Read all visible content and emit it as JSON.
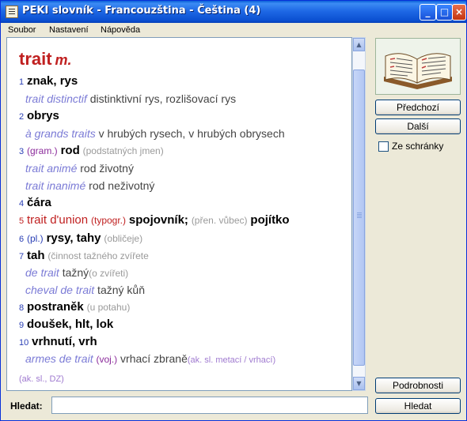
{
  "window": {
    "title": "PEKI slovník - Francouzština - Čeština  (4)",
    "min": "_",
    "max": "□",
    "close": "×"
  },
  "menu": [
    "Soubor",
    "Nastavení",
    "Nápověda"
  ],
  "entry": {
    "headword": "trait",
    "gender": "m.",
    "l1": {
      "num": "1",
      "text": "znak, rys"
    },
    "l2": {
      "fr": "trait distinctif",
      "cz": " distinktivní rys, rozlišovací rys"
    },
    "l3": {
      "num": "2",
      "text": "obrys"
    },
    "l4": {
      "fr": "à grands traits",
      "cz": " v hrubých rysech, v hrubých obrysech"
    },
    "l5": {
      "num": "3",
      "gram": "(gram.)",
      "text": "rod",
      "note": "(podstatných jmen)"
    },
    "l6": {
      "fr": "trait animé",
      "cz": " rod životný"
    },
    "l7": {
      "fr": "trait inanimé",
      "cz": " rod neživotný"
    },
    "l8": {
      "num": "4",
      "text": "čára"
    },
    "l9": {
      "num": "5",
      "phrase": "trait d'union",
      "typ": "(typogr.)",
      "text": "spojovník;",
      "note": "(přen. vůbec)",
      "text2": "pojítko"
    },
    "l10": {
      "num": "6",
      "gram": "(pl.)",
      "text": "rysy, tahy",
      "note": "(obličeje)"
    },
    "l11": {
      "num": "7",
      "text": "tah",
      "note": "(činnost tažného zvířete"
    },
    "l12": {
      "fr": "de trait",
      "cz": " tažný",
      "note": "(o zvířeti)"
    },
    "l13": {
      "fr": "cheval de trait",
      "cz": " tažný kůň"
    },
    "l14": {
      "num": "8",
      "text": "postraněk",
      "note": "(u potahu)"
    },
    "l15": {
      "num": "9",
      "text": "doušek, hlt, lok"
    },
    "l16": {
      "num": "10",
      "text": "vrhnutí, vrh"
    },
    "l17": {
      "fr": "armes de trait",
      "voj": "(voj.)",
      "cz": " vrhací zbraně",
      "src": "(ak. sl. metací / vrhací)"
    },
    "l18": {
      "src": "(ak. sl., DZ)"
    }
  },
  "buttons": {
    "prev": "Předchozí",
    "next": "Další",
    "details": "Podrobnosti",
    "search": "Hledat"
  },
  "clipboard": {
    "label": "Ze schránky",
    "checked": false
  },
  "search": {
    "label": "Hledat:",
    "value": ""
  },
  "icons": {
    "app": "book-app-icon",
    "picture": "open-book-icon"
  }
}
